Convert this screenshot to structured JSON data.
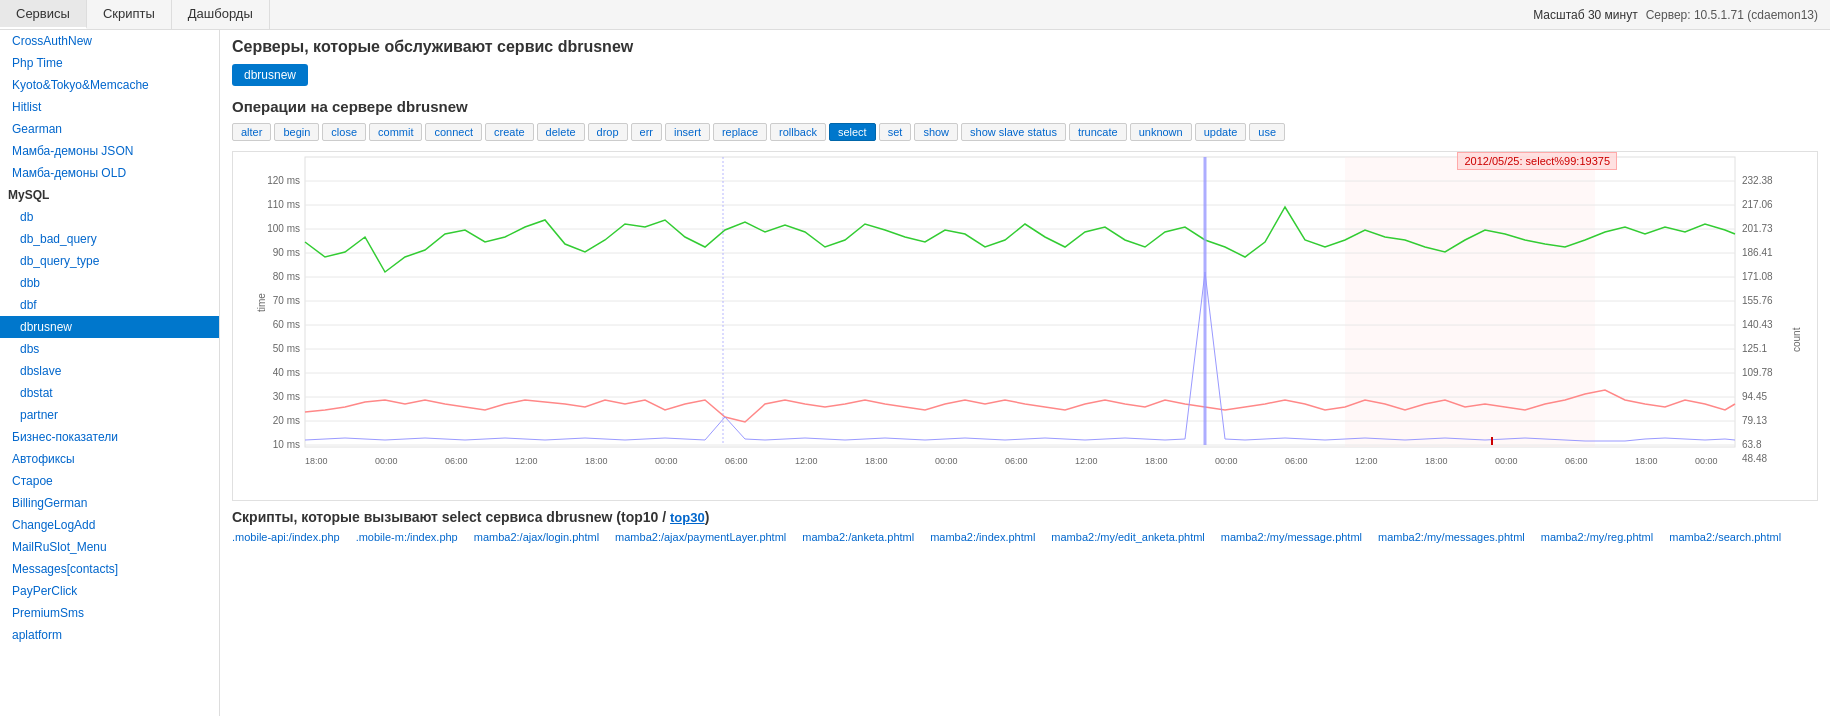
{
  "topNav": {
    "tabs": [
      {
        "label": "Сервисы",
        "active": true
      },
      {
        "label": "Скрипты",
        "active": false
      },
      {
        "label": "Дашборды",
        "active": false
      }
    ],
    "right": {
      "scale": "Масштаб 30 минут",
      "server": "Сервер: 10.5.1.71 (cdaemon13)"
    }
  },
  "sidebar": {
    "items": [
      {
        "label": "CrossAuthNew",
        "level": "top",
        "active": false
      },
      {
        "label": "Php Time",
        "level": "top",
        "active": false
      },
      {
        "label": "Kyoto&Tokyo&Memcache",
        "level": "top",
        "active": false
      },
      {
        "label": "Hitlist",
        "level": "top",
        "active": false
      },
      {
        "label": "Gearman",
        "level": "top",
        "active": false
      },
      {
        "label": "Мамба-демоны JSON",
        "level": "top",
        "active": false
      },
      {
        "label": "Мамба-демоны OLD",
        "level": "top",
        "active": false
      },
      {
        "label": "MySQL",
        "level": "section",
        "active": false
      },
      {
        "label": "db",
        "level": "sub",
        "active": false
      },
      {
        "label": "db_bad_query",
        "level": "sub",
        "active": false
      },
      {
        "label": "db_query_type",
        "level": "sub",
        "active": false
      },
      {
        "label": "dbb",
        "level": "sub",
        "active": false
      },
      {
        "label": "dbf",
        "level": "sub",
        "active": false
      },
      {
        "label": "dbrusnew",
        "level": "sub",
        "active": true
      },
      {
        "label": "dbs",
        "level": "sub",
        "active": false
      },
      {
        "label": "dbslave",
        "level": "sub",
        "active": false
      },
      {
        "label": "dbstat",
        "level": "sub",
        "active": false
      },
      {
        "label": "partner",
        "level": "sub",
        "active": false
      },
      {
        "label": "Бизнес-показатели",
        "level": "top",
        "active": false
      },
      {
        "label": "Автофиксы",
        "level": "top",
        "active": false
      },
      {
        "label": "Старое",
        "level": "top",
        "active": false
      },
      {
        "label": "BillingGerman",
        "level": "top",
        "active": false
      },
      {
        "label": "ChangeLogAdd",
        "level": "top",
        "active": false
      },
      {
        "label": "MailRuSlot_Menu",
        "level": "top",
        "active": false
      },
      {
        "label": "Messages[contacts]",
        "level": "top",
        "active": false
      },
      {
        "label": "PayPerClick",
        "level": "top",
        "active": false
      },
      {
        "label": "PremiumSms",
        "level": "top",
        "active": false
      },
      {
        "label": "aplatform",
        "level": "top",
        "active": false
      }
    ]
  },
  "content": {
    "pageTitle": "Серверы, которые обслуживают сервис dbrusnew",
    "serviceBtn": "dbrusnew",
    "opsTitle": "Операции на сервере dbrusnew",
    "operations": [
      {
        "label": "alter",
        "active": false
      },
      {
        "label": "begin",
        "active": false
      },
      {
        "label": "close",
        "active": false
      },
      {
        "label": "commit",
        "active": false
      },
      {
        "label": "connect",
        "active": false
      },
      {
        "label": "create",
        "active": false
      },
      {
        "label": "delete",
        "active": false
      },
      {
        "label": "drop",
        "active": false
      },
      {
        "label": "err",
        "active": false
      },
      {
        "label": "insert",
        "active": false
      },
      {
        "label": "replace",
        "active": false
      },
      {
        "label": "rollback",
        "active": false
      },
      {
        "label": "select",
        "active": true
      },
      {
        "label": "set",
        "active": false
      },
      {
        "label": "show",
        "active": false
      },
      {
        "label": "show slave status",
        "active": false
      },
      {
        "label": "truncate",
        "active": false
      },
      {
        "label": "unknown",
        "active": false
      },
      {
        "label": "update",
        "active": false
      },
      {
        "label": "use",
        "active": false
      }
    ],
    "chart": {
      "tooltip": "2012/05/25: select%99:19375",
      "yAxisLeft": [
        "120 ms",
        "110 ms",
        "100 ms",
        "90 ms",
        "80 ms",
        "70 ms",
        "60 ms",
        "50 ms",
        "40 ms",
        "30 ms",
        "20 ms",
        "10 ms"
      ],
      "yAxisRight": [
        "232.38",
        "217.06",
        "201.73",
        "186.41",
        "171.08",
        "155.76",
        "140.43",
        "125.1",
        "109.78",
        "94.45",
        "79.13",
        "63.8",
        "48.48"
      ],
      "xAxisLabels": [
        "18:00",
        "00:00",
        "06:00",
        "12:00",
        "18:00",
        "00:00",
        "06:00",
        "12:00",
        "18:00",
        "00:00",
        "06:00",
        "12:00",
        "18:00",
        "00:00",
        "06:00",
        "12:00",
        "18:00",
        "00:00",
        "06:00",
        "00:00"
      ],
      "yLeftTitle": "time",
      "yRightTitle": "count"
    },
    "scriptsTitle": "Скрипты, которые вызывают select сервиса dbrusnew (top10 /",
    "top30Label": "top30",
    "scripts": [
      ".mobile-api:/index.php",
      ".mobile-m:/index.php",
      "mamba2:/ajax/login.phtml",
      "mamba2:/ajax/paymentLayer.phtml",
      "mamba2:/anketa.phtml",
      "mamba2:/index.phtml",
      "mamba2:/my/edit_anketa.phtml",
      "mamba2:/my/message.phtml",
      "mamba2:/my/messages.phtml",
      "mamba2:/my/reg.phtml",
      "mamba2:/search.phtml"
    ]
  }
}
